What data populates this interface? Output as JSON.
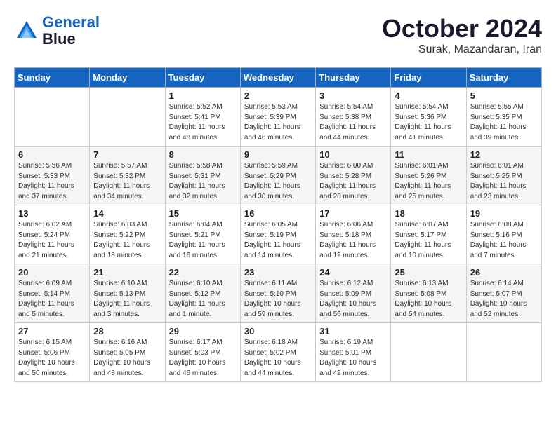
{
  "header": {
    "logo_line1": "General",
    "logo_line2": "Blue",
    "month": "October 2024",
    "location": "Surak, Mazandaran, Iran"
  },
  "days_of_week": [
    "Sunday",
    "Monday",
    "Tuesday",
    "Wednesday",
    "Thursday",
    "Friday",
    "Saturday"
  ],
  "weeks": [
    [
      {
        "day": "",
        "info": ""
      },
      {
        "day": "",
        "info": ""
      },
      {
        "day": "1",
        "info": "Sunrise: 5:52 AM\nSunset: 5:41 PM\nDaylight: 11 hours\nand 48 minutes."
      },
      {
        "day": "2",
        "info": "Sunrise: 5:53 AM\nSunset: 5:39 PM\nDaylight: 11 hours\nand 46 minutes."
      },
      {
        "day": "3",
        "info": "Sunrise: 5:54 AM\nSunset: 5:38 PM\nDaylight: 11 hours\nand 44 minutes."
      },
      {
        "day": "4",
        "info": "Sunrise: 5:54 AM\nSunset: 5:36 PM\nDaylight: 11 hours\nand 41 minutes."
      },
      {
        "day": "5",
        "info": "Sunrise: 5:55 AM\nSunset: 5:35 PM\nDaylight: 11 hours\nand 39 minutes."
      }
    ],
    [
      {
        "day": "6",
        "info": "Sunrise: 5:56 AM\nSunset: 5:33 PM\nDaylight: 11 hours\nand 37 minutes."
      },
      {
        "day": "7",
        "info": "Sunrise: 5:57 AM\nSunset: 5:32 PM\nDaylight: 11 hours\nand 34 minutes."
      },
      {
        "day": "8",
        "info": "Sunrise: 5:58 AM\nSunset: 5:31 PM\nDaylight: 11 hours\nand 32 minutes."
      },
      {
        "day": "9",
        "info": "Sunrise: 5:59 AM\nSunset: 5:29 PM\nDaylight: 11 hours\nand 30 minutes."
      },
      {
        "day": "10",
        "info": "Sunrise: 6:00 AM\nSunset: 5:28 PM\nDaylight: 11 hours\nand 28 minutes."
      },
      {
        "day": "11",
        "info": "Sunrise: 6:01 AM\nSunset: 5:26 PM\nDaylight: 11 hours\nand 25 minutes."
      },
      {
        "day": "12",
        "info": "Sunrise: 6:01 AM\nSunset: 5:25 PM\nDaylight: 11 hours\nand 23 minutes."
      }
    ],
    [
      {
        "day": "13",
        "info": "Sunrise: 6:02 AM\nSunset: 5:24 PM\nDaylight: 11 hours\nand 21 minutes."
      },
      {
        "day": "14",
        "info": "Sunrise: 6:03 AM\nSunset: 5:22 PM\nDaylight: 11 hours\nand 18 minutes."
      },
      {
        "day": "15",
        "info": "Sunrise: 6:04 AM\nSunset: 5:21 PM\nDaylight: 11 hours\nand 16 minutes."
      },
      {
        "day": "16",
        "info": "Sunrise: 6:05 AM\nSunset: 5:19 PM\nDaylight: 11 hours\nand 14 minutes."
      },
      {
        "day": "17",
        "info": "Sunrise: 6:06 AM\nSunset: 5:18 PM\nDaylight: 11 hours\nand 12 minutes."
      },
      {
        "day": "18",
        "info": "Sunrise: 6:07 AM\nSunset: 5:17 PM\nDaylight: 11 hours\nand 10 minutes."
      },
      {
        "day": "19",
        "info": "Sunrise: 6:08 AM\nSunset: 5:16 PM\nDaylight: 11 hours\nand 7 minutes."
      }
    ],
    [
      {
        "day": "20",
        "info": "Sunrise: 6:09 AM\nSunset: 5:14 PM\nDaylight: 11 hours\nand 5 minutes."
      },
      {
        "day": "21",
        "info": "Sunrise: 6:10 AM\nSunset: 5:13 PM\nDaylight: 11 hours\nand 3 minutes."
      },
      {
        "day": "22",
        "info": "Sunrise: 6:10 AM\nSunset: 5:12 PM\nDaylight: 11 hours\nand 1 minute."
      },
      {
        "day": "23",
        "info": "Sunrise: 6:11 AM\nSunset: 5:10 PM\nDaylight: 10 hours\nand 59 minutes."
      },
      {
        "day": "24",
        "info": "Sunrise: 6:12 AM\nSunset: 5:09 PM\nDaylight: 10 hours\nand 56 minutes."
      },
      {
        "day": "25",
        "info": "Sunrise: 6:13 AM\nSunset: 5:08 PM\nDaylight: 10 hours\nand 54 minutes."
      },
      {
        "day": "26",
        "info": "Sunrise: 6:14 AM\nSunset: 5:07 PM\nDaylight: 10 hours\nand 52 minutes."
      }
    ],
    [
      {
        "day": "27",
        "info": "Sunrise: 6:15 AM\nSunset: 5:06 PM\nDaylight: 10 hours\nand 50 minutes."
      },
      {
        "day": "28",
        "info": "Sunrise: 6:16 AM\nSunset: 5:05 PM\nDaylight: 10 hours\nand 48 minutes."
      },
      {
        "day": "29",
        "info": "Sunrise: 6:17 AM\nSunset: 5:03 PM\nDaylight: 10 hours\nand 46 minutes."
      },
      {
        "day": "30",
        "info": "Sunrise: 6:18 AM\nSunset: 5:02 PM\nDaylight: 10 hours\nand 44 minutes."
      },
      {
        "day": "31",
        "info": "Sunrise: 6:19 AM\nSunset: 5:01 PM\nDaylight: 10 hours\nand 42 minutes."
      },
      {
        "day": "",
        "info": ""
      },
      {
        "day": "",
        "info": ""
      }
    ]
  ]
}
